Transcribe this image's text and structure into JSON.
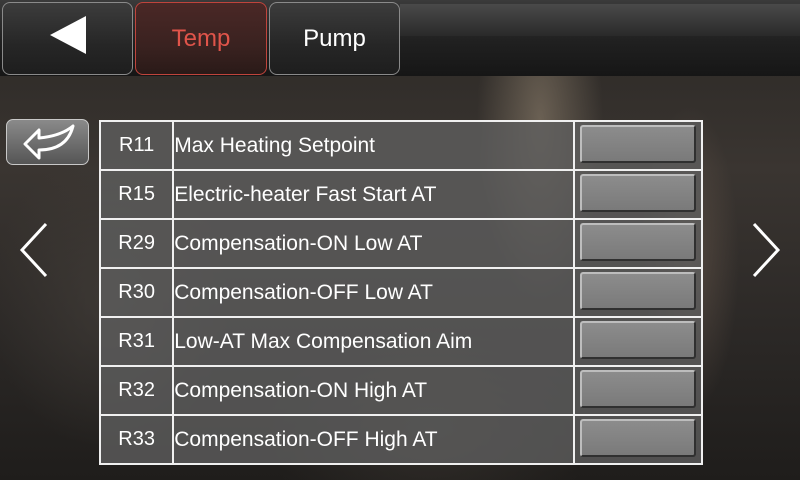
{
  "header": {
    "back_icon": "back-triangle-icon",
    "tabs": [
      {
        "label": "Temp",
        "active": true,
        "color": "#e0544a"
      },
      {
        "label": "Pump",
        "active": false
      }
    ]
  },
  "return_button": {
    "icon": "return-arrow-icon"
  },
  "navigation": {
    "prev_icon": "chevron-left-icon",
    "next_icon": "chevron-right-icon"
  },
  "parameters": [
    {
      "code": "R11",
      "name": "Max Heating Setpoint",
      "value": ""
    },
    {
      "code": "R15",
      "name": "Electric-heater Fast Start AT",
      "value": ""
    },
    {
      "code": "R29",
      "name": "Compensation-ON Low AT",
      "value": ""
    },
    {
      "code": "R30",
      "name": "Compensation-OFF Low AT",
      "value": ""
    },
    {
      "code": "R31",
      "name": "Low-AT Max Compensation Aim",
      "value": ""
    },
    {
      "code": "R32",
      "name": "Compensation-ON High AT",
      "value": ""
    },
    {
      "code": "R33",
      "name": "Compensation-OFF High AT",
      "value": ""
    }
  ]
}
